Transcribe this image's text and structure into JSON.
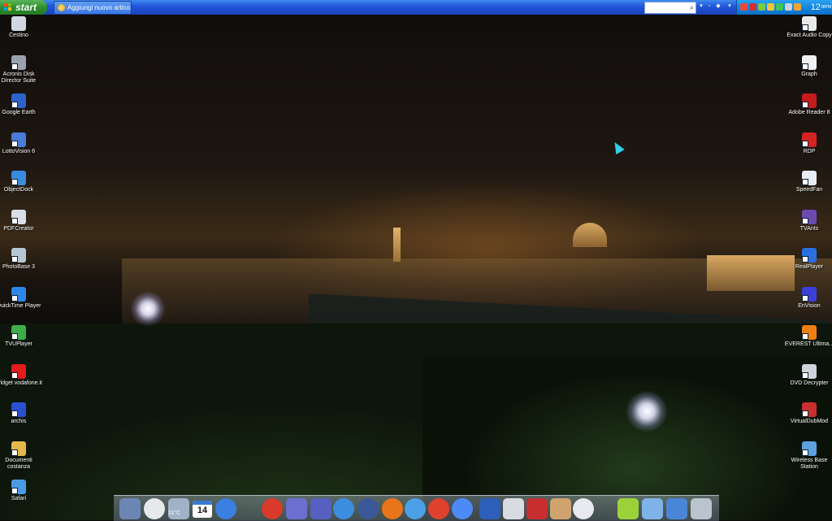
{
  "taskbar": {
    "start_label": "start",
    "task_label": "Aggiungi nuovo artico...",
    "search_placeholder": "",
    "clock": "12",
    "clock_minutes": "38",
    "clock_ampm": "PM"
  },
  "desktop_left": [
    {
      "label": "Cestino",
      "icon": "recycle-bin-icon",
      "color": "#cfd8e0"
    },
    {
      "label": "Acronis Disk Director Suite",
      "icon": "acronis-icon",
      "color": "#9aa3ad"
    },
    {
      "label": "Google Earth",
      "icon": "globe-icon",
      "color": "#2c62c9"
    },
    {
      "label": "LottoVision 6",
      "icon": "eye-icon",
      "color": "#4a7bd8"
    },
    {
      "label": "ObjectDock",
      "icon": "objectdock-icon",
      "color": "#3a8be0"
    },
    {
      "label": "PDFCreator",
      "icon": "pdf-icon",
      "color": "#d8dde6"
    },
    {
      "label": "PhotoBase 3",
      "icon": "photobase-icon",
      "color": "#b7c6d4"
    },
    {
      "label": "QuickTime Player",
      "icon": "quicktime-icon",
      "color": "#2e86e8"
    },
    {
      "label": "TVUPlayer",
      "icon": "tvu-icon",
      "color": "#3fae49"
    },
    {
      "label": "Widget vodafone.it",
      "icon": "vodafone-icon",
      "color": "#e21b1b"
    },
    {
      "label": "archis",
      "icon": "folder-icon",
      "color": "#2b4fd1"
    },
    {
      "label": "Documenti costanza",
      "icon": "folder-icon",
      "color": "#e4b84a"
    },
    {
      "label": "Safari",
      "icon": "compass-icon",
      "color": "#4a9be6"
    }
  ],
  "desktop_right": [
    {
      "label": "Exact Audio Copy",
      "icon": "eac-icon",
      "color": "#e8e8e8"
    },
    {
      "label": "Graph",
      "icon": "graph-icon",
      "color": "#f0f0f0"
    },
    {
      "label": "Adobe Reader 8",
      "icon": "adobe-icon",
      "color": "#c61b1b"
    },
    {
      "label": "RDP",
      "icon": "rdp-icon",
      "color": "#d62222"
    },
    {
      "label": "SpeedFan",
      "icon": "fan-icon",
      "color": "#e8eef3"
    },
    {
      "label": "TVAnts",
      "icon": "tvants-icon",
      "color": "#6b4bb0"
    },
    {
      "label": "RealPlayer",
      "icon": "realplayer-icon",
      "color": "#2a6fe0"
    },
    {
      "label": "EnVision",
      "icon": "monitor-icon",
      "color": "#3a3fd8"
    },
    {
      "label": "EVEREST Ultima...",
      "icon": "info-icon",
      "color": "#f07f12"
    },
    {
      "label": "DVD Decrypter",
      "icon": "dvd-icon",
      "color": "#d0d4da"
    },
    {
      "label": "VirtualDubMod",
      "icon": "virtualdub-icon",
      "color": "#c93030"
    },
    {
      "label": "Wireless Base Station",
      "icon": "wireless-icon",
      "color": "#5ba0e0"
    }
  ],
  "dock": {
    "weather_temp": "11°C",
    "calendar_day": "14",
    "items": [
      {
        "icon": "mail-icon",
        "color": "#6b86b5"
      },
      {
        "icon": "clock-icon",
        "color": "#e6e8ec"
      },
      {
        "icon": "weather-icon",
        "color": "#9fb2c8"
      },
      {
        "icon": "calendar-icon",
        "color": "#ffffff"
      },
      {
        "icon": "windows-start-icon",
        "color": "#3b7fe0"
      },
      {
        "icon": "power-icon",
        "color": "#d93a2b"
      },
      {
        "icon": "photo-icon",
        "color": "#6c6fd0"
      },
      {
        "icon": "photo-app-icon",
        "color": "#5560c0"
      },
      {
        "icon": "messenger-icon",
        "color": "#3c8de0"
      },
      {
        "icon": "facebook-icon",
        "color": "#3b5998"
      },
      {
        "icon": "firefox-icon",
        "color": "#e8751a"
      },
      {
        "icon": "safari-icon",
        "color": "#4ca0e6"
      },
      {
        "icon": "chrome-icon",
        "color": "#e0412f"
      },
      {
        "icon": "google-icon",
        "color": "#4c8bf5"
      },
      {
        "icon": "word-icon",
        "color": "#2b5fb8"
      },
      {
        "icon": "notes-icon",
        "color": "#d8dbe0"
      },
      {
        "icon": "book-icon",
        "color": "#c92e2e"
      },
      {
        "icon": "tools-icon",
        "color": "#d0a36e"
      },
      {
        "icon": "media-player-icon",
        "color": "#e7e9ee"
      },
      {
        "icon": "wifi-icon",
        "color": "#9bd23a"
      },
      {
        "icon": "network-icon",
        "color": "#7fb3e8"
      },
      {
        "icon": "settings-icon",
        "color": "#4a86d8"
      },
      {
        "icon": "trash-icon",
        "color": "#b9c4cf"
      }
    ]
  }
}
